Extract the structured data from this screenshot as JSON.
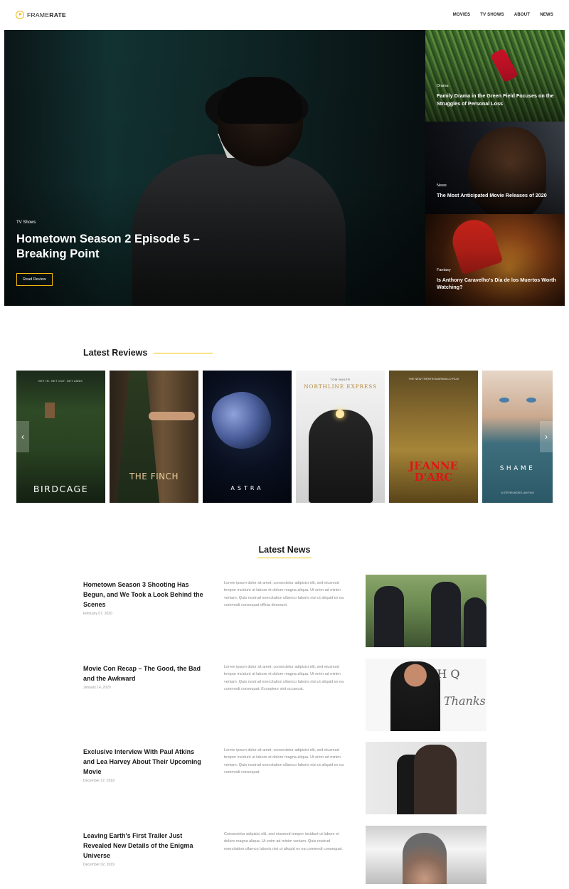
{
  "header": {
    "logo_text_light": "FRAME",
    "logo_text_bold": "RATE",
    "nav": [
      "MOVIES",
      "TV SHOWS",
      "ABOUT",
      "NEWS"
    ]
  },
  "hero": {
    "main": {
      "category": "TV Shows",
      "title": "Hometown Season 2 Episode 5 – Breaking Point",
      "button": "Read Review"
    },
    "side": [
      {
        "category": "Drama",
        "title": "Family Drama in the Green Field Focuses on the Struggles of Personal Loss"
      },
      {
        "category": "News",
        "title": "The Most Anticipated Movie Releases of 2020"
      },
      {
        "category": "Fantasy",
        "title": "Is Anthony Caravelho's Día de los Muertos Worth Watching?"
      }
    ]
  },
  "reviews": {
    "title": "Latest Reviews",
    "posters": [
      {
        "title": "BIRDCAGE",
        "tagline": "GET IN. GET OUT. GET AWAY."
      },
      {
        "title": "THE FINCH"
      },
      {
        "title": "ASTRA"
      },
      {
        "title": "NORTHLINE EXPRESS",
        "tagline": "TOM BAKER"
      },
      {
        "title": "JEANNE D'ARC",
        "tagline": "THE NEW TRENTIN MARAVILLO FILM"
      },
      {
        "title": "SHAME",
        "tagline": "A STEVEN MCKELLAN FILM"
      }
    ],
    "arrows": {
      "prev": "‹",
      "next": "›"
    }
  },
  "news": {
    "title": "Latest News",
    "items": [
      {
        "headline": "Hometown Season 3 Shooting Has Begun, and We Took a Look Behind the Scenes",
        "date": "February 07, 2020",
        "body": "Lorem ipsum dolor sit amet, consectetur adipisici elit, sed eiusmod tempor incidunt ut labore et dolore magna aliqua. Ut enim ad minim veniam. Quis nostrud exercitation ullamco laboris nisi ut aliquid ex ea commodi consequat officia deserunt."
      },
      {
        "headline": "Movie Con Recap – The Good, the Bad and the Awkward",
        "date": "January 14, 2020",
        "body": "Lorem ipsum dolor sit amet, consectetur adipisici elit, sed eiusmod tempor incidunt ut labore et dolore magna aliqua. Ut enim ad minim veniam. Quis nostrud exercitation ullamco laboris nisi ut aliquid ex ea commodi consequat. Excepteur sint occaecat."
      },
      {
        "headline": "Exclusive Interview With Paul Atkins and Lea Harvey About Their Upcoming Movie",
        "date": "December 17, 2019",
        "body": "Lorem ipsum dolor sit amet, consectetur adipisici elit, sed eiusmod tempor incidunt ut labore et dolore magna aliqua. Ut enim ad minim veniam. Quis nostrud exercitation ullamco laboris nisi ut aliquid ex ea commodi consequat."
      },
      {
        "headline": "Leaving Earth's First Trailer Just Revealed New Details of the Enigma Universe",
        "date": "December 02, 2019",
        "body": "Consectetur adipisici elit, sed eiusmod tempor incidunt ut labore et dolore magna aliqua. Ut enim ad minim veniam. Quis nostrud exercitation ullamco laboris nisi ut aliquid ex ea commodi consequat."
      }
    ],
    "image_text": {
      "sign_top": "RINH Q",
      "sign_script": "Thanks"
    }
  },
  "colors": {
    "accent": "#f2c300",
    "logo": "#f2b90f"
  }
}
